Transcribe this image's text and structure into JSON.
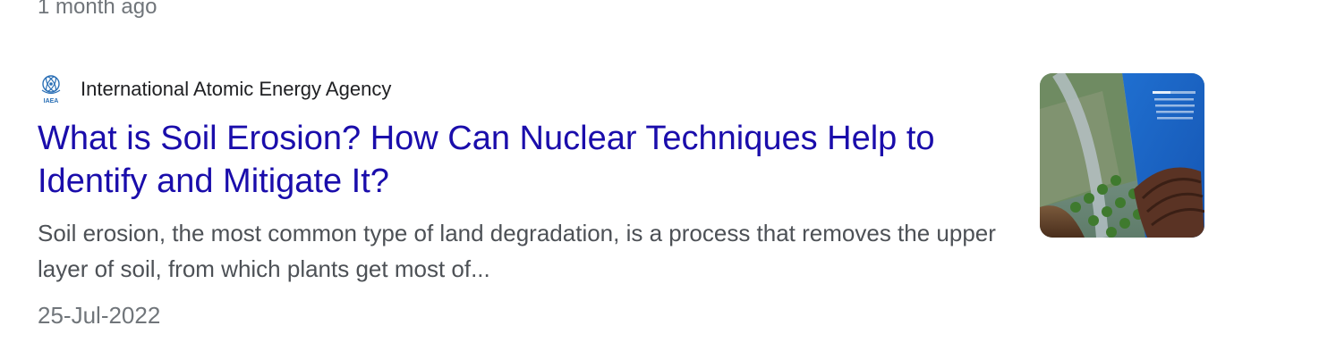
{
  "previous_result": {
    "time": "1 month ago"
  },
  "result": {
    "source": {
      "favicon": "iaea-logo-icon",
      "favicon_text": "IAEA",
      "name": "International Atomic Energy Agency"
    },
    "title": "What is Soil Erosion? How Can Nuclear Techniques Help to Identify and Mitigate It?",
    "snippet": "Soil erosion, the most common type of land degradation, is a process that removes the upper layer of soil, from which plants get most of...",
    "date": "25-Jul-2022",
    "thumbnail": "soil-erosion-infographic-thumbnail"
  },
  "colors": {
    "title_link": "#1a0dab",
    "snippet_text": "#4d5156",
    "meta_text": "#70757a",
    "source_text": "#202124",
    "iaea_blue": "#2a6fb5"
  }
}
